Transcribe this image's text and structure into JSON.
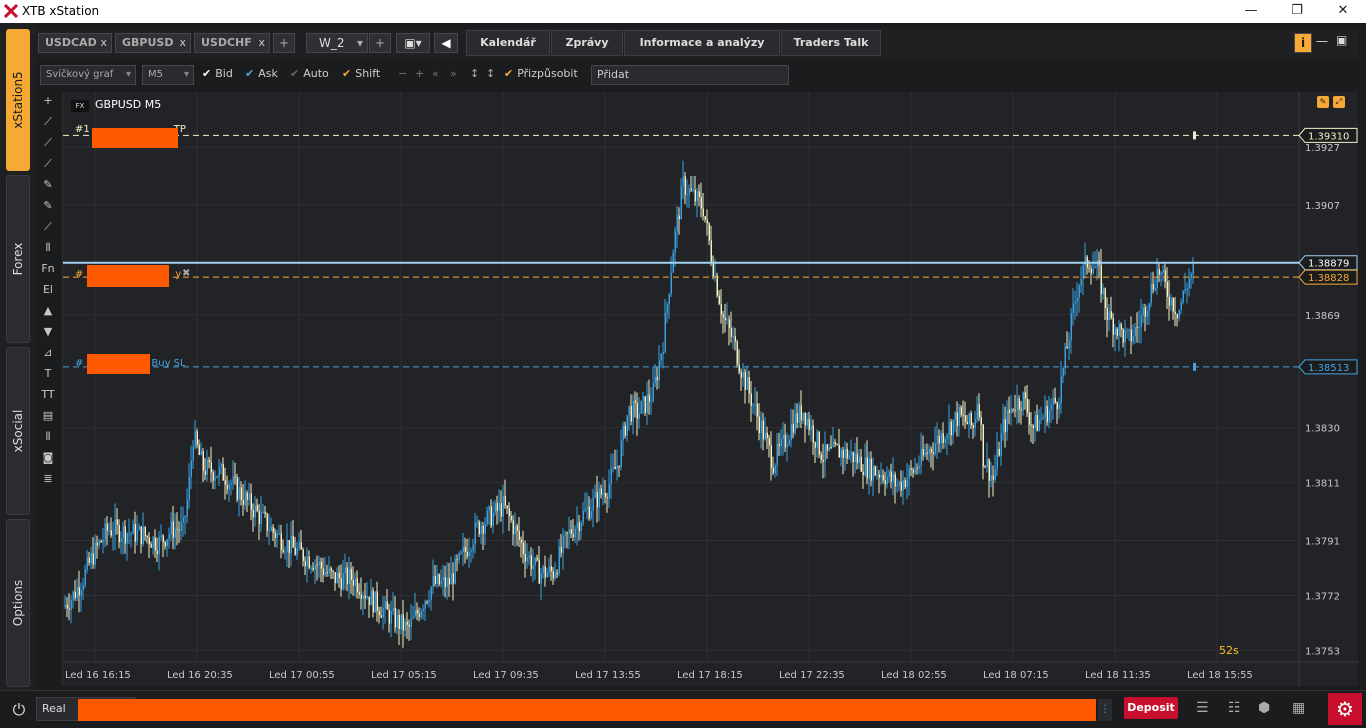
{
  "window": {
    "title": "XTB xStation",
    "min": "—",
    "max": "❐",
    "close": "✕"
  },
  "sidebar": {
    "tabs": [
      "xStation5",
      "Forex",
      "xSocial",
      "Options"
    ]
  },
  "tabs": {
    "symbols": [
      {
        "label": "USDCAD",
        "close": "x"
      },
      {
        "label": "GBPUSD",
        "close": "x"
      },
      {
        "label": "USDCHF",
        "close": "x"
      }
    ],
    "add": "+",
    "workspace": "W_2",
    "workspace_add": "+",
    "nav": [
      "Kalendář",
      "Zprávy",
      "Informace a analýzy",
      "Traders Talk"
    ],
    "info_icon": "i",
    "minimize": "—",
    "maximize": "▣"
  },
  "toolbar": {
    "chart_type": "Svíčkový graf",
    "timeframe": "M5",
    "bid_label": "Bid",
    "ask_label": "Ask",
    "auto_label": "Auto",
    "shift_label": "Shift",
    "fit_label": "Přizpůsobit",
    "add_placeholder": "Přidat",
    "colors": {
      "check_white": "#ffffff",
      "check_blue": "#4aa3df",
      "check_orange": "#f7a935"
    }
  },
  "drawtools": [
    "+",
    "⟋",
    "⟋",
    "⟋",
    "✎",
    "✎",
    "⟋",
    "⫴",
    "Fn",
    "El",
    "▲",
    "▼",
    "⊿",
    "T",
    "TT",
    "▤",
    "⫴",
    "◙",
    "≣"
  ],
  "chart": {
    "badge": "FX",
    "symbol": "GBPUSD M5",
    "timer": "52s",
    "tp_label_prefix": "#1",
    "tp_label_suffix": "TP",
    "entry_label_prefix": "#",
    "entry_label_suffix": "y",
    "sl_label_prefix": "#",
    "sl_label_suffix": "Buy  SL",
    "close_x": "✖",
    "colors": {
      "bg": "#222326",
      "grid": "#2e2f33",
      "up": "#3aa0e0",
      "down": "#f2f0c8",
      "tp": "#f2f0c8",
      "entry": "#f7a935",
      "sl": "#4aa3df",
      "current": "#9fd3ef",
      "axis_text": "#c8c8c8"
    }
  },
  "chart_data": {
    "type": "candlestick",
    "symbol": "GBPUSD",
    "timeframe": "M5",
    "y_ticks": [
      "1.3927",
      "1.3907",
      "1.3869",
      "1.3830",
      "1.3811",
      "1.3791",
      "1.3772",
      "1.3753"
    ],
    "y_tick_values": [
      1.3927,
      1.3907,
      1.3869,
      1.383,
      1.3811,
      1.3791,
      1.3772,
      1.3753
    ],
    "ylim": [
      1.3749,
      1.3946
    ],
    "x_ticks": [
      "Led 16 16:15",
      "Led 16 20:35",
      "Led 17 00:55",
      "Led 17 05:15",
      "Led 17 09:35",
      "Led 17 13:55",
      "Led 17 18:15",
      "Led 17 22:35",
      "Led 18 02:55",
      "Led 18 07:15",
      "Led 18 11:35",
      "Led 18 15:55"
    ],
    "levels": [
      {
        "name": "TP",
        "value": 1.3931,
        "label": "1.39310"
      },
      {
        "name": "Ask",
        "value": 1.3887,
        "label": "1.38879"
      },
      {
        "name": "Bid",
        "value": 1.3882,
        "label": "1.38828"
      },
      {
        "name": "SL",
        "value": 1.3851,
        "label": "1.38513"
      }
    ],
    "price_path": [
      [
        0,
        1.3768
      ],
      [
        10,
        1.3772
      ],
      [
        20,
        1.3778
      ],
      [
        30,
        1.3786
      ],
      [
        45,
        1.3795
      ],
      [
        60,
        1.3794
      ],
      [
        80,
        1.3793
      ],
      [
        95,
        1.379
      ],
      [
        110,
        1.3795
      ],
      [
        120,
        1.3795
      ],
      [
        125,
        1.3807
      ],
      [
        130,
        1.3827
      ],
      [
        140,
        1.3816
      ],
      [
        160,
        1.3814
      ],
      [
        175,
        1.3808
      ],
      [
        190,
        1.3802
      ],
      [
        210,
        1.3794
      ],
      [
        230,
        1.3788
      ],
      [
        250,
        1.3784
      ],
      [
        270,
        1.3778
      ],
      [
        290,
        1.3778
      ],
      [
        310,
        1.377
      ],
      [
        330,
        1.3764
      ],
      [
        345,
        1.376
      ],
      [
        360,
        1.377
      ],
      [
        370,
        1.3776
      ],
      [
        385,
        1.3776
      ],
      [
        400,
        1.3786
      ],
      [
        415,
        1.3796
      ],
      [
        430,
        1.38
      ],
      [
        440,
        1.3803
      ],
      [
        450,
        1.3796
      ],
      [
        460,
        1.3788
      ],
      [
        475,
        1.378
      ],
      [
        490,
        1.378
      ],
      [
        505,
        1.3793
      ],
      [
        520,
        1.38
      ],
      [
        535,
        1.3806
      ],
      [
        545,
        1.381
      ],
      [
        555,
        1.3818
      ],
      [
        565,
        1.3836
      ],
      [
        575,
        1.3835
      ],
      [
        590,
        1.3842
      ],
      [
        600,
        1.386
      ],
      [
        610,
        1.3892
      ],
      [
        620,
        1.3914
      ],
      [
        630,
        1.391
      ],
      [
        640,
        1.3906
      ],
      [
        650,
        1.3886
      ],
      [
        660,
        1.3868
      ],
      [
        670,
        1.386
      ],
      [
        680,
        1.3848
      ],
      [
        690,
        1.3838
      ],
      [
        700,
        1.3828
      ],
      [
        710,
        1.3818
      ],
      [
        720,
        1.3824
      ],
      [
        730,
        1.3832
      ],
      [
        740,
        1.3836
      ],
      [
        750,
        1.3828
      ],
      [
        760,
        1.382
      ],
      [
        775,
        1.3822
      ],
      [
        790,
        1.382
      ],
      [
        805,
        1.3816
      ],
      [
        820,
        1.3814
      ],
      [
        835,
        1.381
      ],
      [
        850,
        1.3815
      ],
      [
        865,
        1.3822
      ],
      [
        880,
        1.3828
      ],
      [
        895,
        1.3834
      ],
      [
        910,
        1.383
      ],
      [
        915,
        1.3842
      ],
      [
        920,
        1.382
      ],
      [
        930,
        1.3812
      ],
      [
        940,
        1.383
      ],
      [
        950,
        1.3838
      ],
      [
        960,
        1.384
      ],
      [
        970,
        1.383
      ],
      [
        985,
        1.3836
      ],
      [
        995,
        1.384
      ],
      [
        1005,
        1.386
      ],
      [
        1015,
        1.388
      ],
      [
        1025,
        1.3888
      ],
      [
        1035,
        1.3884
      ],
      [
        1045,
        1.3868
      ],
      [
        1055,
        1.3864
      ],
      [
        1065,
        1.386
      ],
      [
        1075,
        1.3865
      ],
      [
        1085,
        1.3875
      ],
      [
        1095,
        1.3885
      ],
      [
        1105,
        1.3876
      ],
      [
        1115,
        1.387
      ],
      [
        1125,
        1.3881
      ],
      [
        1130,
        1.3884
      ]
    ]
  },
  "bottombar": {
    "power_icon": "⏻",
    "account_type": "Real",
    "deposit": "Deposit",
    "settings_icon": "⚙"
  }
}
